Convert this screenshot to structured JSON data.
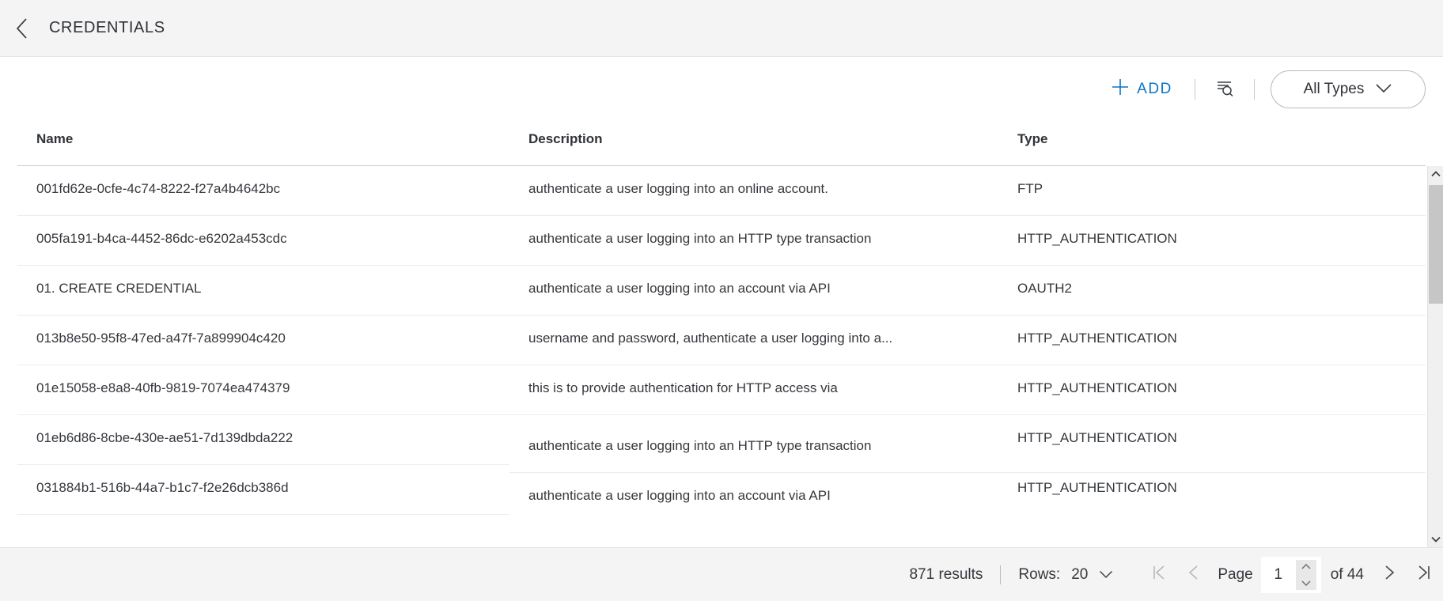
{
  "header": {
    "back_icon": "chevron-left-icon",
    "title": "CREDENTIALS"
  },
  "toolbar": {
    "add_label": "ADD",
    "add_icon": "plus-icon",
    "add_color": "#0a74c4",
    "filter_search_icon": "filter-search-icon",
    "type_filter_value": "All Types",
    "type_filter_icon": "chevron-down-icon"
  },
  "table": {
    "columns": [
      "Name",
      "Description",
      "Type"
    ],
    "rows": [
      {
        "name": "001fd62e-0cfe-4c74-8222-f27a4b4642bc",
        "description": "authenticate a user logging into an online account.",
        "type": "FTP",
        "offset": false
      },
      {
        "name": "005fa191-b4ca-4452-86dc-e6202a453cdc",
        "description": "authenticate a user logging into an HTTP type transaction",
        "type": "HTTP_AUTHENTICATION",
        "offset": false
      },
      {
        "name": "01. CREATE CREDENTIAL",
        "description": "authenticate a user logging into an account via API",
        "type": "OAUTH2",
        "offset": false
      },
      {
        "name": "013b8e50-95f8-47ed-a47f-7a899904c420",
        "description": "username and password, authenticate a user logging into a...",
        "type": "HTTP_AUTHENTICATION",
        "offset": false
      },
      {
        "name": "01e15058-e8a8-40fb-9819-7074ea474379",
        "description": "this is to provide authentication for HTTP access via",
        "type": "HTTP_AUTHENTICATION",
        "offset": false
      },
      {
        "name": "01eb6d86-8cbe-430e-ae51-7d139dbda222",
        "description": "authenticate a user logging into an HTTP type transaction",
        "type": "HTTP_AUTHENTICATION",
        "offset": true
      },
      {
        "name": "031884b1-516b-44a7-b1c7-f2e26dcb386d",
        "description": "authenticate a user logging into an account via API",
        "type": "HTTP_AUTHENTICATION",
        "offset": true
      }
    ]
  },
  "scrollbar": {
    "up_icon": "chevron-up-icon",
    "down_icon": "chevron-down-icon"
  },
  "footer": {
    "results_text": "871 results",
    "rows_label": "Rows:",
    "rows_value": "20",
    "rows_icon": "chevron-down-icon",
    "first_page_icon": "first-page-icon",
    "prev_page_icon": "chevron-left-icon",
    "page_label": "Page",
    "page_value": "1",
    "of_label": "of 44",
    "next_page_icon": "chevron-right-icon",
    "last_page_icon": "last-page-icon"
  }
}
